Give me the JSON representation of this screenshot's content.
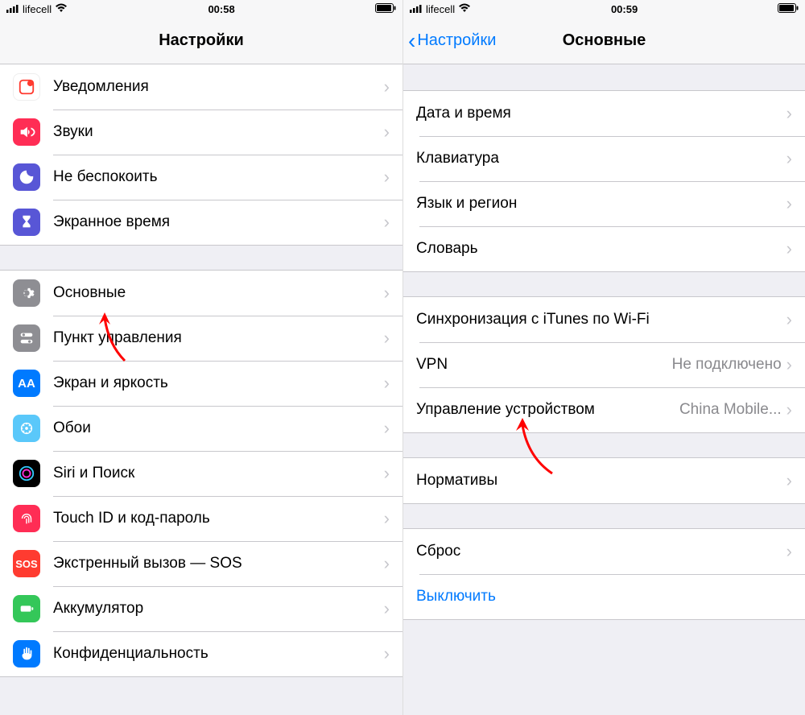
{
  "left": {
    "status": {
      "carrier": "lifecell",
      "time": "00:58"
    },
    "title": "Настройки",
    "group1": [
      {
        "key": "notifications",
        "label": "Уведомления"
      },
      {
        "key": "sounds",
        "label": "Звуки"
      },
      {
        "key": "dnd",
        "label": "Не беспокоить"
      },
      {
        "key": "screentime",
        "label": "Экранное время"
      }
    ],
    "group2": [
      {
        "key": "general",
        "label": "Основные"
      },
      {
        "key": "controlcenter",
        "label": "Пункт управления"
      },
      {
        "key": "display",
        "label": "Экран и яркость"
      },
      {
        "key": "wallpaper",
        "label": "Обои"
      },
      {
        "key": "siri",
        "label": "Siri и Поиск"
      },
      {
        "key": "touchid",
        "label": "Touch ID и код-пароль"
      },
      {
        "key": "sos",
        "label": "Экстренный вызов — SOS"
      },
      {
        "key": "battery",
        "label": "Аккумулятор"
      },
      {
        "key": "privacy",
        "label": "Конфиденциальность"
      }
    ]
  },
  "right": {
    "status": {
      "carrier": "lifecell",
      "time": "00:59"
    },
    "back": "Настройки",
    "title": "Основные",
    "group1": [
      {
        "key": "datetime",
        "label": "Дата и время"
      },
      {
        "key": "keyboard",
        "label": "Клавиатура"
      },
      {
        "key": "language",
        "label": "Язык и регион"
      },
      {
        "key": "dictionary",
        "label": "Словарь"
      }
    ],
    "group2": [
      {
        "key": "itunes",
        "label": "Синхронизация с iTunes по Wi-Fi"
      },
      {
        "key": "vpn",
        "label": "VPN",
        "value": "Не подключено"
      },
      {
        "key": "devicemgmt",
        "label": "Управление устройством",
        "value": "China Mobile..."
      }
    ],
    "group3": [
      {
        "key": "regulatory",
        "label": "Нормативы"
      }
    ],
    "group4": [
      {
        "key": "reset",
        "label": "Сброс"
      },
      {
        "key": "shutdown",
        "label": "Выключить",
        "link": true,
        "nochevron": true
      }
    ]
  }
}
